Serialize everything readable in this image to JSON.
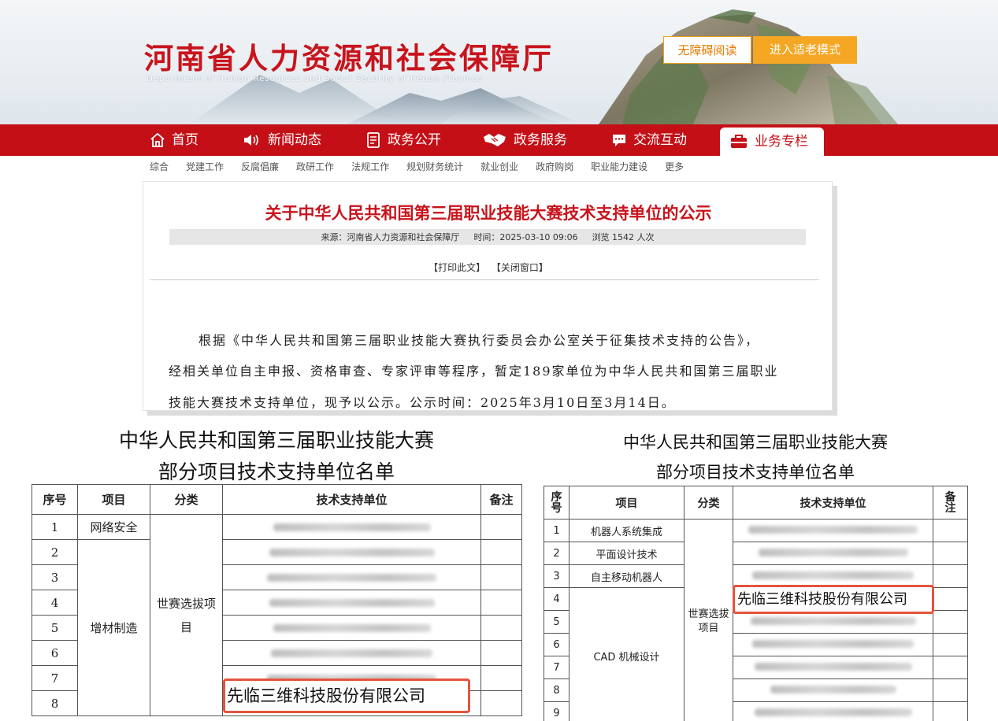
{
  "site": {
    "title": "河南省人力资源和社会保障厅",
    "subtitle": "Department of Human Resources and Social Security of Henan Province",
    "accessibility_label": "无障碍阅读",
    "elder_mode_label": "进入适老模式"
  },
  "nav": {
    "items": [
      {
        "label": "首页",
        "icon": "home-icon"
      },
      {
        "label": "新闻动态",
        "icon": "speaker-icon"
      },
      {
        "label": "政务公开",
        "icon": "document-icon"
      },
      {
        "label": "政务服务",
        "icon": "handshake-icon"
      },
      {
        "label": "交流互动",
        "icon": "chat-icon"
      },
      {
        "label": "业务专栏",
        "icon": "briefcase-icon"
      }
    ],
    "active_index": 5,
    "colors": {
      "primary": "#c40f16",
      "accent": "#f5a623"
    }
  },
  "subnav": [
    "综合",
    "党建工作",
    "反腐倡廉",
    "政研工作",
    "法规工作",
    "规划财务统计",
    "就业创业",
    "政府购岗",
    "职业能力建设",
    "更多"
  ],
  "article": {
    "title": "关于中华人民共和国第三届职业技能大赛技术支持单位的公示",
    "source": "来源：河南省人力资源和社会保障厅",
    "time": "时间：2025-03-10 09:06",
    "views": "浏览 1542 人次",
    "print_label": "【打印此文】",
    "close_label": "【关闭窗口】",
    "paragraph_lines": [
      "根据《中华人民共和国第三届职业技能大赛执行委员会办公室关于征集技术支持的公告》，",
      "经相关单位自主申报、资格审查、专家评审等程序，暂定189家单位为中华人民共和国第三届职业",
      "技能大赛技术支持单位，现予以公示。公示时间：2025年3月10日至3月14日。"
    ]
  },
  "table_left": {
    "heading_line1": "中华人民共和国第三届职业技能大赛",
    "heading_line2": "部分项目技术支持单位名单",
    "headers": [
      "序号",
      "项目",
      "分类",
      "技术支持单位",
      "备注"
    ],
    "rows": [
      "1",
      "2",
      "3",
      "4",
      "5",
      "6",
      "7",
      "8"
    ],
    "project_first": "网络安全",
    "project_rest": "增材制造",
    "category": "世赛选拔项目",
    "highlight": "先临三维科技股份有限公司"
  },
  "table_right": {
    "heading_line1": "中华人民共和国第三届职业技能大赛",
    "heading_line2": "部分项目技术支持单位名单",
    "headers": [
      "序号",
      "项目",
      "分类",
      "技术支持单位",
      "备注"
    ],
    "rows": [
      "1",
      "2",
      "3",
      "4",
      "5",
      "6",
      "7",
      "8",
      "9"
    ],
    "projects": [
      "机器人系统集成",
      "平面设计技术",
      "自主移动机器人",
      "CAD 机械设计"
    ],
    "category": "世赛选拔项目",
    "highlight": "先临三维科技股份有限公司"
  }
}
